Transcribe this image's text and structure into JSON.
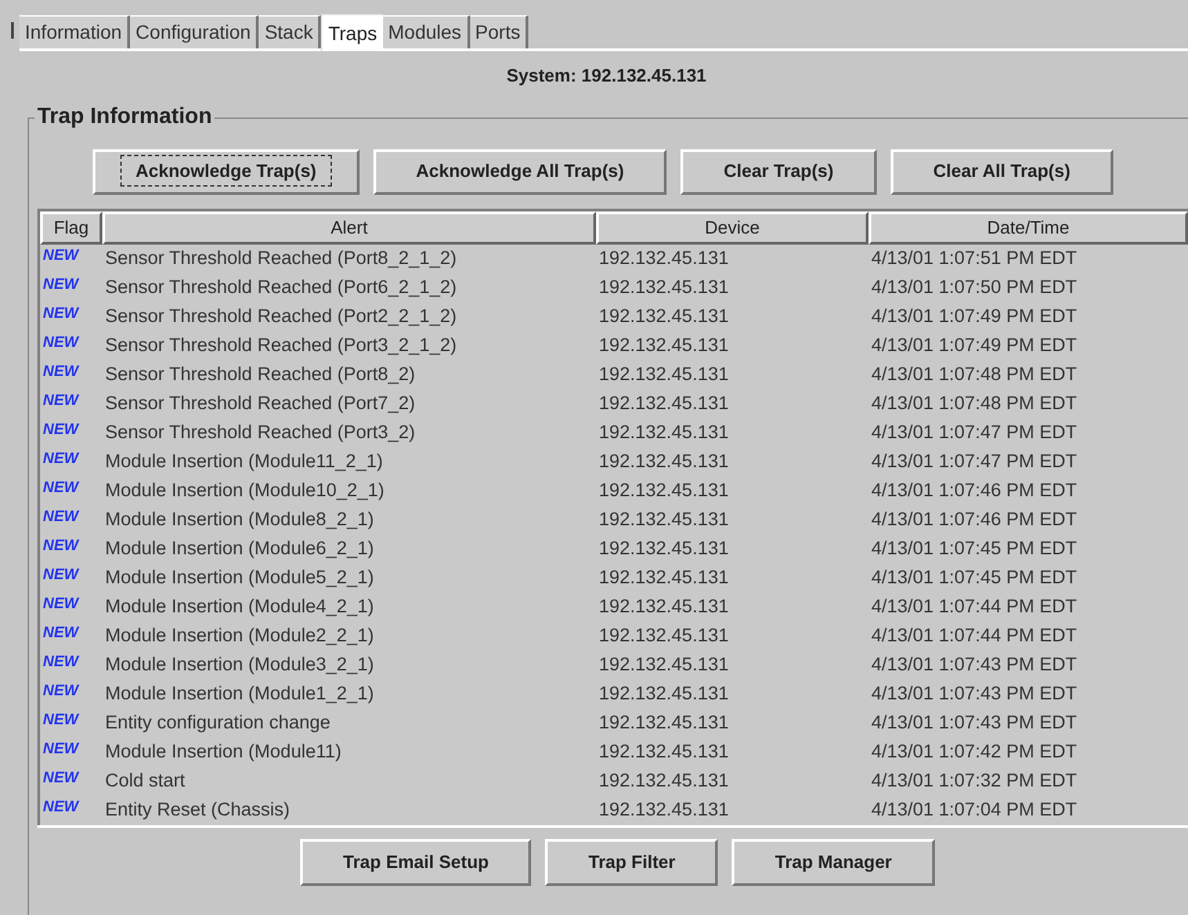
{
  "tabs": [
    {
      "label": "Information",
      "selected": false
    },
    {
      "label": "Configuration",
      "selected": false
    },
    {
      "label": "Stack",
      "selected": false
    },
    {
      "label": "Traps",
      "selected": true
    },
    {
      "label": "Modules",
      "selected": false
    },
    {
      "label": "Ports",
      "selected": false
    }
  ],
  "system_label": "System: 192.132.45.131",
  "group_title": "Trap Information",
  "top_buttons": [
    {
      "label": "Acknowledge Trap(s)",
      "focused": true
    },
    {
      "label": "Acknowledge All Trap(s)",
      "focused": false
    },
    {
      "label": "Clear Trap(s)",
      "focused": false
    },
    {
      "label": "Clear All Trap(s)",
      "focused": false
    }
  ],
  "table": {
    "columns": [
      "Flag",
      "Alert",
      "Device",
      "Date/Time"
    ],
    "rows": [
      {
        "flag": "NEW",
        "alert": "Sensor Threshold Reached (Port8_2_1_2)",
        "device": "192.132.45.131",
        "datetime": "4/13/01 1:07:51 PM EDT"
      },
      {
        "flag": "NEW",
        "alert": "Sensor Threshold Reached (Port6_2_1_2)",
        "device": "192.132.45.131",
        "datetime": "4/13/01 1:07:50 PM EDT"
      },
      {
        "flag": "NEW",
        "alert": "Sensor Threshold Reached (Port2_2_1_2)",
        "device": "192.132.45.131",
        "datetime": "4/13/01 1:07:49 PM EDT"
      },
      {
        "flag": "NEW",
        "alert": "Sensor Threshold Reached (Port3_2_1_2)",
        "device": "192.132.45.131",
        "datetime": "4/13/01 1:07:49 PM EDT"
      },
      {
        "flag": "NEW",
        "alert": "Sensor Threshold Reached (Port8_2)",
        "device": "192.132.45.131",
        "datetime": "4/13/01 1:07:48 PM EDT"
      },
      {
        "flag": "NEW",
        "alert": "Sensor Threshold Reached (Port7_2)",
        "device": "192.132.45.131",
        "datetime": "4/13/01 1:07:48 PM EDT"
      },
      {
        "flag": "NEW",
        "alert": "Sensor Threshold Reached (Port3_2)",
        "device": "192.132.45.131",
        "datetime": "4/13/01 1:07:47 PM EDT"
      },
      {
        "flag": "NEW",
        "alert": "Module Insertion (Module11_2_1)",
        "device": "192.132.45.131",
        "datetime": "4/13/01 1:07:47 PM EDT"
      },
      {
        "flag": "NEW",
        "alert": "Module Insertion (Module10_2_1)",
        "device": "192.132.45.131",
        "datetime": "4/13/01 1:07:46 PM EDT"
      },
      {
        "flag": "NEW",
        "alert": "Module Insertion (Module8_2_1)",
        "device": "192.132.45.131",
        "datetime": "4/13/01 1:07:46 PM EDT"
      },
      {
        "flag": "NEW",
        "alert": "Module Insertion (Module6_2_1)",
        "device": "192.132.45.131",
        "datetime": "4/13/01 1:07:45 PM EDT"
      },
      {
        "flag": "NEW",
        "alert": "Module Insertion (Module5_2_1)",
        "device": "192.132.45.131",
        "datetime": "4/13/01 1:07:45 PM EDT"
      },
      {
        "flag": "NEW",
        "alert": "Module Insertion (Module4_2_1)",
        "device": "192.132.45.131",
        "datetime": "4/13/01 1:07:44 PM EDT"
      },
      {
        "flag": "NEW",
        "alert": "Module Insertion (Module2_2_1)",
        "device": "192.132.45.131",
        "datetime": "4/13/01 1:07:44 PM EDT"
      },
      {
        "flag": "NEW",
        "alert": "Module Insertion (Module3_2_1)",
        "device": "192.132.45.131",
        "datetime": "4/13/01 1:07:43 PM EDT"
      },
      {
        "flag": "NEW",
        "alert": "Module Insertion (Module1_2_1)",
        "device": "192.132.45.131",
        "datetime": "4/13/01 1:07:43 PM EDT"
      },
      {
        "flag": "NEW",
        "alert": "Entity configuration change",
        "device": "192.132.45.131",
        "datetime": "4/13/01 1:07:43 PM EDT"
      },
      {
        "flag": "NEW",
        "alert": "Module Insertion (Module11)",
        "device": "192.132.45.131",
        "datetime": "4/13/01 1:07:42 PM EDT"
      },
      {
        "flag": "NEW",
        "alert": "Cold start",
        "device": "192.132.45.131",
        "datetime": "4/13/01 1:07:32 PM EDT"
      },
      {
        "flag": "NEW",
        "alert": "Entity Reset (Chassis)",
        "device": "192.132.45.131",
        "datetime": "4/13/01 1:07:04 PM EDT"
      }
    ]
  },
  "bottom_buttons": [
    {
      "label": "Trap Email Setup",
      "focused": false
    },
    {
      "label": "Trap Filter",
      "focused": false
    },
    {
      "label": "Trap Manager",
      "focused": false
    }
  ]
}
